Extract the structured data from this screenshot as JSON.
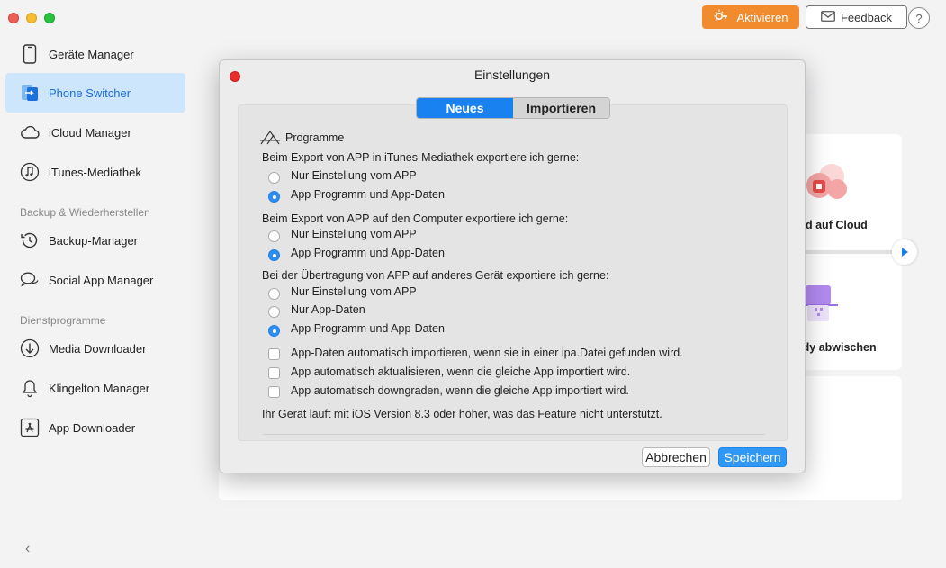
{
  "window": {
    "title": ""
  },
  "header": {
    "activate_label": "Aktivieren",
    "feedback_label": "Feedback",
    "help_label": "?"
  },
  "sidebar": {
    "items": [
      {
        "label": "Geräte Manager",
        "icon": "phone-icon",
        "active": false
      },
      {
        "label": "Phone Switcher",
        "icon": "phone-switch-icon",
        "active": true
      },
      {
        "label": "iCloud Manager",
        "icon": "cloud-icon",
        "active": false
      },
      {
        "label": "iTunes-Mediathek",
        "icon": "music-note-icon",
        "active": false
      },
      {
        "label": "Backup-Manager",
        "icon": "history-icon",
        "active": false
      },
      {
        "label": "Social App Manager",
        "icon": "chat-bubbles-icon",
        "active": false
      },
      {
        "label": "Media Downloader",
        "icon": "download-icon",
        "active": false
      },
      {
        "label": "Klingelton Manager",
        "icon": "bell-icon",
        "active": false
      },
      {
        "label": "App Downloader",
        "icon": "app-store-icon",
        "active": false
      }
    ],
    "sections": [
      "Backup & Wiederherstellen",
      "Dienstprogramme"
    ],
    "collapse_label": "‹"
  },
  "background": {
    "card1_text": "d auf Cloud",
    "card2_text": "ndy abwischen"
  },
  "dialog": {
    "title": "Einstellungen",
    "tabs": [
      {
        "label": "Neues",
        "active": true
      },
      {
        "label": "Importieren",
        "active": false
      }
    ],
    "section_title": "Programme",
    "group1": {
      "question": "Beim Export von APP in iTunes-Mediathek exportiere ich gerne:",
      "options": [
        {
          "label": "Nur Einstellung vom APP",
          "checked": false
        },
        {
          "label": "App Programm und App-Daten",
          "checked": true
        }
      ]
    },
    "group2": {
      "question": "Beim Export von APP auf den Computer exportiere ich gerne:",
      "options": [
        {
          "label": "Nur Einstellung vom APP",
          "checked": false
        },
        {
          "label": "App Programm und App-Daten",
          "checked": true
        }
      ]
    },
    "group3": {
      "question": "Bei der Übertragung von APP auf anderes Gerät exportiere ich gerne:",
      "options": [
        {
          "label": "Nur Einstellung vom APP",
          "checked": false
        },
        {
          "label": "Nur App-Daten",
          "checked": false
        },
        {
          "label": "App Programm und App-Daten",
          "checked": true
        }
      ]
    },
    "checkboxes": [
      {
        "label": "App-Daten automatisch importieren, wenn sie in einer ipa.Datei gefunden wird.",
        "checked": false
      },
      {
        "label": "App automatisch aktualisieren, wenn die gleiche App importiert wird.",
        "checked": false
      },
      {
        "label": "App automatisch downgraden, wenn die gleiche App importiert wird.",
        "checked": false
      }
    ],
    "note": "Ihr Gerät läuft mit iOS Version 8.3 oder höher, was das Feature nicht unterstützt.",
    "cancel_label": "Abbrechen",
    "save_label": "Speichern"
  },
  "colors": {
    "accent": "#1a82f0",
    "activate": "#f28a2e",
    "sidebar_active_bg": "#cde6fb",
    "close_red": "#e92d2d"
  }
}
